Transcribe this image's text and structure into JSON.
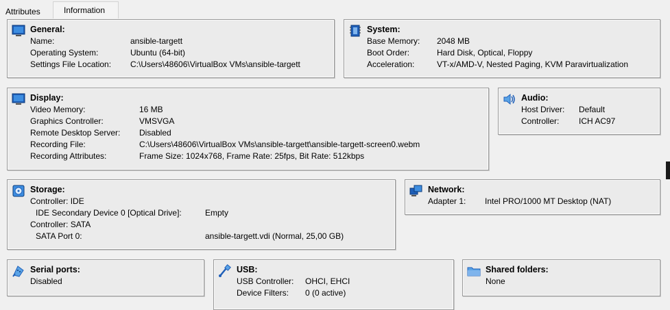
{
  "tabs": [
    {
      "label": "Attributes"
    },
    {
      "label": "Information"
    }
  ],
  "general": {
    "title": "General:",
    "rows": [
      {
        "label": "Name:",
        "value": "ansible-targett"
      },
      {
        "label": "Operating System:",
        "value": "Ubuntu (64-bit)"
      },
      {
        "label": "Settings File Location:",
        "value": "C:\\Users\\48606\\VirtualBox VMs\\ansible-targett"
      }
    ]
  },
  "system": {
    "title": "System:",
    "rows": [
      {
        "label": "Base Memory:",
        "value": "2048 MB"
      },
      {
        "label": "Boot Order:",
        "value": "Hard Disk, Optical, Floppy"
      },
      {
        "label": "Acceleration:",
        "value": "VT-x/AMD-V, Nested Paging, KVM Paravirtualization"
      }
    ]
  },
  "display": {
    "title": "Display:",
    "rows": [
      {
        "label": "Video Memory:",
        "value": "16 MB"
      },
      {
        "label": "Graphics Controller:",
        "value": "VMSVGA"
      },
      {
        "label": "Remote Desktop Server:",
        "value": "Disabled"
      },
      {
        "label": "Recording File:",
        "value": "C:\\Users\\48606\\VirtualBox VMs\\ansible-targett\\ansible-targett-screen0.webm"
      },
      {
        "label": "Recording Attributes:",
        "value": "Frame Size: 1024x768, Frame Rate: 25fps, Bit Rate: 512kbps"
      }
    ]
  },
  "audio": {
    "title": "Audio:",
    "rows": [
      {
        "label": "Host Driver:",
        "value": "Default"
      },
      {
        "label": "Controller:",
        "value": "ICH AC97"
      }
    ]
  },
  "storage": {
    "title": "Storage:",
    "rows": [
      {
        "label": "Controller: IDE",
        "value": ""
      },
      {
        "label": "IDE Secondary Device 0 [Optical Drive]:",
        "value": "Empty"
      },
      {
        "label": "Controller: SATA",
        "value": ""
      },
      {
        "label": "SATA Port 0:",
        "value": "ansible-targett.vdi (Normal, 25,00 GB)"
      }
    ]
  },
  "network": {
    "title": "Network:",
    "rows": [
      {
        "label": "Adapter 1:",
        "value": "Intel PRO/1000 MT Desktop (NAT)"
      }
    ]
  },
  "serial": {
    "title": "Serial ports:",
    "rows": [
      {
        "label": "Disabled",
        "value": ""
      }
    ]
  },
  "usb": {
    "title": "USB:",
    "rows": [
      {
        "label": "USB Controller:",
        "value": "OHCI, EHCI"
      },
      {
        "label": "Device Filters:",
        "value": "0 (0 active)"
      }
    ]
  },
  "shared": {
    "title": "Shared folders:",
    "rows": [
      {
        "label": "None",
        "value": ""
      }
    ]
  },
  "colors": {
    "background": "#f0f0f0",
    "box_background": "#ebebeb",
    "box_border": "#9a9a9a",
    "icon_blue": "#1f6fc6"
  }
}
